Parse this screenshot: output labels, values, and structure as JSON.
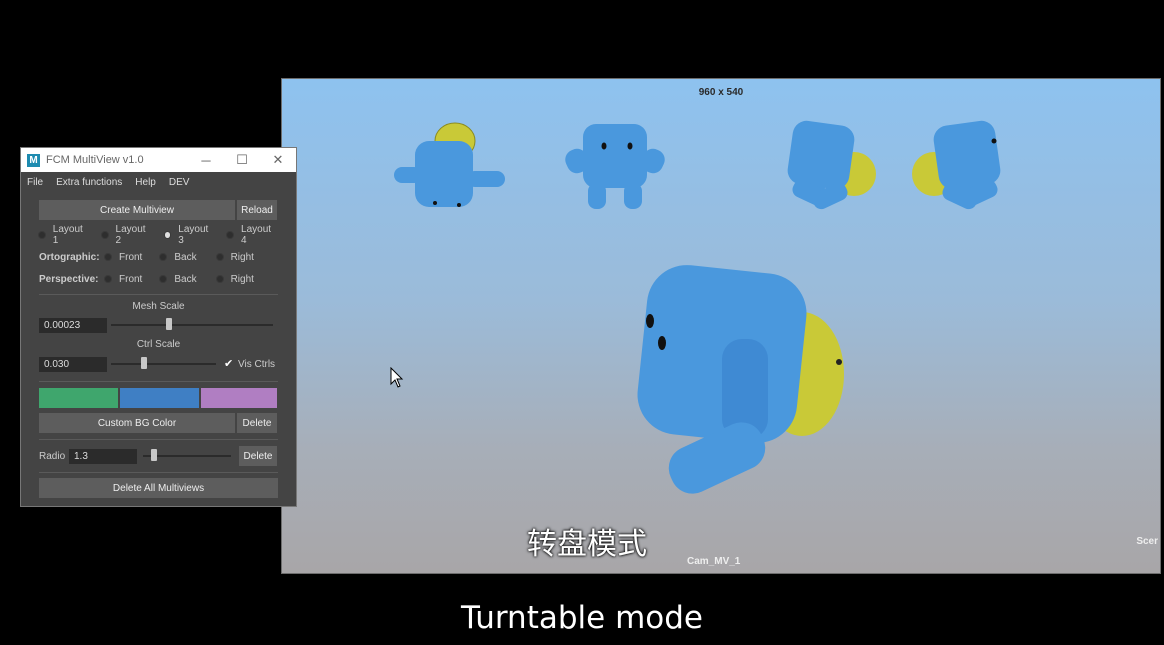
{
  "window": {
    "title": "FCM MultiView v1.0",
    "app_icon_letter": "M",
    "controls": {
      "minimize": "─",
      "maximize": "☐",
      "close": "✕"
    }
  },
  "menu": [
    "File",
    "Extra functions",
    "Help",
    "DEV"
  ],
  "buttons": {
    "create": "Create Multiview",
    "reload": "Reload",
    "custom_bg": "Custom BG Color",
    "delete_bg": "Delete",
    "delete_radio": "Delete",
    "delete_all": "Delete All Multiviews"
  },
  "layouts": {
    "options": [
      "Layout 1",
      "Layout 2",
      "Layout 3",
      "Layout 4"
    ],
    "selected": "Layout 3"
  },
  "ortographic": {
    "label": "Ortographic:",
    "options": [
      "Front",
      "Back",
      "Right"
    ]
  },
  "perspective": {
    "label": "Perspective:",
    "options": [
      "Front",
      "Back",
      "Right"
    ]
  },
  "mesh_scale": {
    "label": "Mesh Scale",
    "value": "0.00023",
    "slider": 0.35
  },
  "ctrl_scale": {
    "label": "Ctrl Scale",
    "value": "0.030",
    "slider": 0.3,
    "vis_label": "Vis Ctrls",
    "vis_checked": true
  },
  "colors": [
    "#3fa66d",
    "#3f7fc4",
    "#b07ec2"
  ],
  "radio_field": {
    "label": "Radio",
    "value": "1.3",
    "slider": 0.1
  },
  "viewport": {
    "resolution": "960 x 540",
    "camera": "Cam_MV_1",
    "corner": "Scer",
    "caption_cn": "转盘模式"
  },
  "caption_en": "Turntable mode"
}
